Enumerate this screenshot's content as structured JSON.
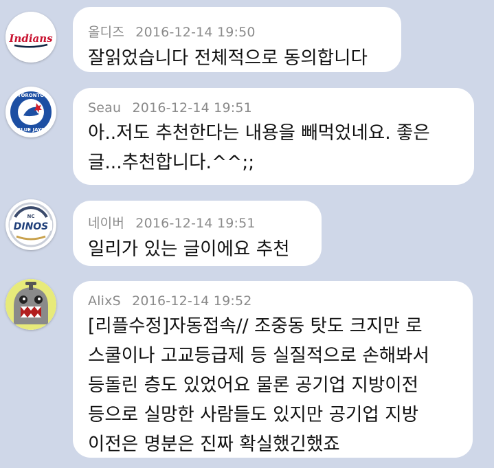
{
  "messages": [
    {
      "author": "올디즈",
      "time": "2016-12-14 19:50",
      "text": "잘읽었습니다 전체적으로 동의합니다",
      "avatar_icon": "indians-logo"
    },
    {
      "author": "Seau",
      "time": "2016-12-14 19:51",
      "text": "아..저도 추천한다는 내용을 빼먹었네요. 좋은\n글...추천합니다.^^;;",
      "avatar_icon": "blue-jays-logo"
    },
    {
      "author": "네이버",
      "time": "2016-12-14 19:51",
      "text": "일리가 있는 글이에요 추천",
      "avatar_icon": "nc-dinos-logo"
    },
    {
      "author": "AlixS",
      "time": "2016-12-14 19:52",
      "text": "[리플수정]자동접속// 조중동 탓도 크지만 로\n스쿨이나 고교등급제 등 실질적으로 손해봐서\n등돌린 층도 있었어요 물론 공기업 지방이전\n등으로 실망한 사람들도 있지만 공기업 지방\n이전은 명분은 진짜 확실했긴했죠",
      "avatar_icon": "monster-character-avatar"
    }
  ],
  "logo_text": {
    "indians": "Indians",
    "blue_jays_top": "TORONTO",
    "blue_jays_bottom": "BLUE JAYS",
    "dinos_small": "NC",
    "dinos": "DINOS"
  }
}
